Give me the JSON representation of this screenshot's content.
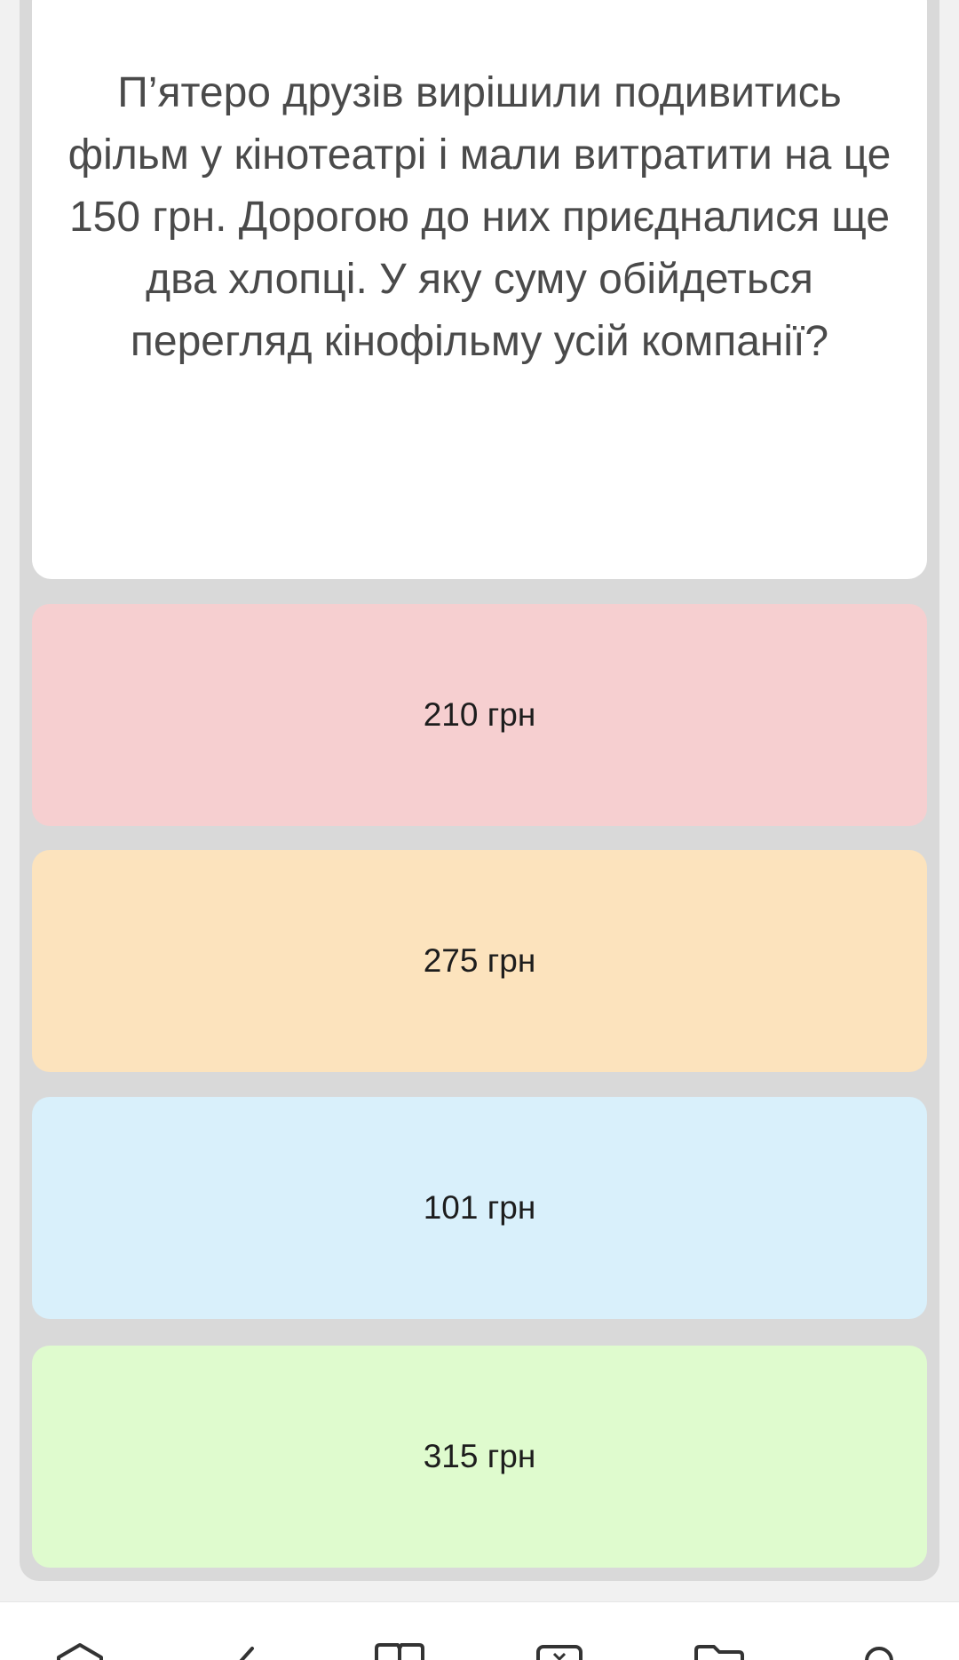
{
  "question": {
    "text": "П’ятеро друзів вирішили подивитись фільм у кінотеатрі і мали витратити на це 150 грн. Дорогою до них приєдналися ще два хлопці. У яку суму обійдеться перегляд кінофільму усій компанії?"
  },
  "answers": [
    {
      "label": "210 грн",
      "color": "#f6cfd0"
    },
    {
      "label": "275 грн",
      "color": "#fce3bd"
    },
    {
      "label": "101 грн",
      "color": "#d9f0fb"
    },
    {
      "label": "315 грн",
      "color": "#dffbce"
    }
  ],
  "bottom_nav": {
    "items": [
      {
        "icon": "home-icon"
      },
      {
        "icon": "pencil-icon"
      },
      {
        "icon": "book-icon"
      },
      {
        "icon": "inbox-icon"
      },
      {
        "icon": "folder-icon"
      },
      {
        "icon": "profile-icon"
      }
    ]
  }
}
